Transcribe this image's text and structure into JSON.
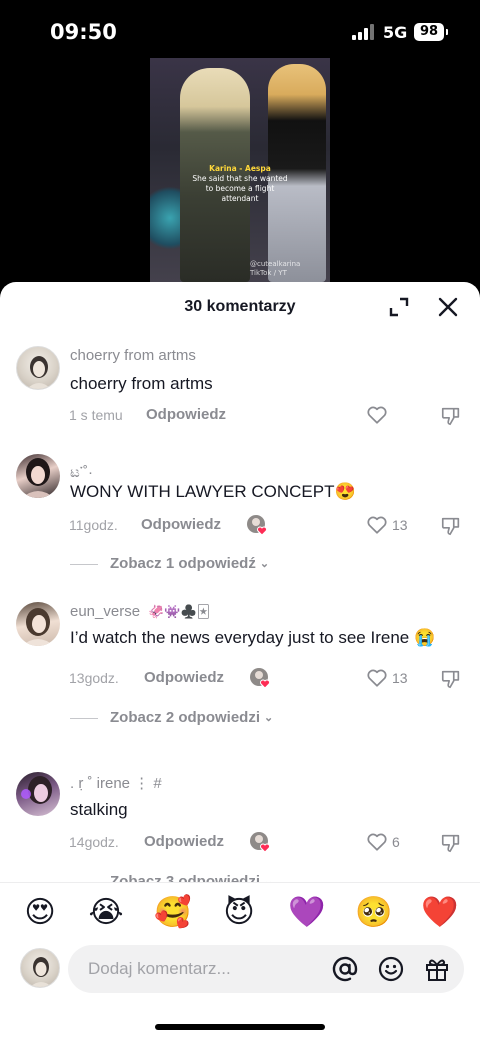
{
  "status_bar": {
    "time": "09:50",
    "network": "5G",
    "battery": "98"
  },
  "video": {
    "caption_head": "Karina - Aespa",
    "caption_body": "She said that she wanted to become a flight attendant",
    "watermark_1": "@cutealkarina",
    "watermark_2": "TikTok / YT"
  },
  "sheet": {
    "title": "30 komentarzy"
  },
  "comments": [
    {
      "username": "choerry from artms",
      "text": "choerry from artms",
      "time": "1 s temu",
      "reply": "Odpowiedz",
      "likes": "",
      "view_replies": ""
    },
    {
      "username": "ಟ་˚·",
      "text": "WONY WITH LAWYER CONCEPT😍",
      "time": "11godz.",
      "reply": "Odpowiedz",
      "likes": "13",
      "view_replies": "Zobacz 1 odpowiedź"
    },
    {
      "username": "eun_verse",
      "username_emoji": "🦑👾♣️🃏",
      "text": "I’d watch the news everyday just to see Irene 😭",
      "time": "13godz.",
      "reply": "Odpowiedz",
      "likes": "13",
      "view_replies": "Zobacz 2 odpowiedzi"
    },
    {
      "username": ". ṛ ˚ irene  ⋮ #",
      "text": "stalking",
      "time": "14godz.",
      "reply": "Odpowiedz",
      "likes": "6",
      "view_replies": "Zobacz 3 odpowiedzi"
    }
  ],
  "emoji_bar": [
    "😍",
    "😭",
    "🥰",
    "😈",
    "💜",
    "🥺",
    "❤️"
  ],
  "input": {
    "placeholder": "Dodaj komentarz..."
  },
  "colors": {
    "like_pink": "#fe2c55",
    "text_primary": "#161823",
    "text_secondary": "#8a8b91"
  }
}
